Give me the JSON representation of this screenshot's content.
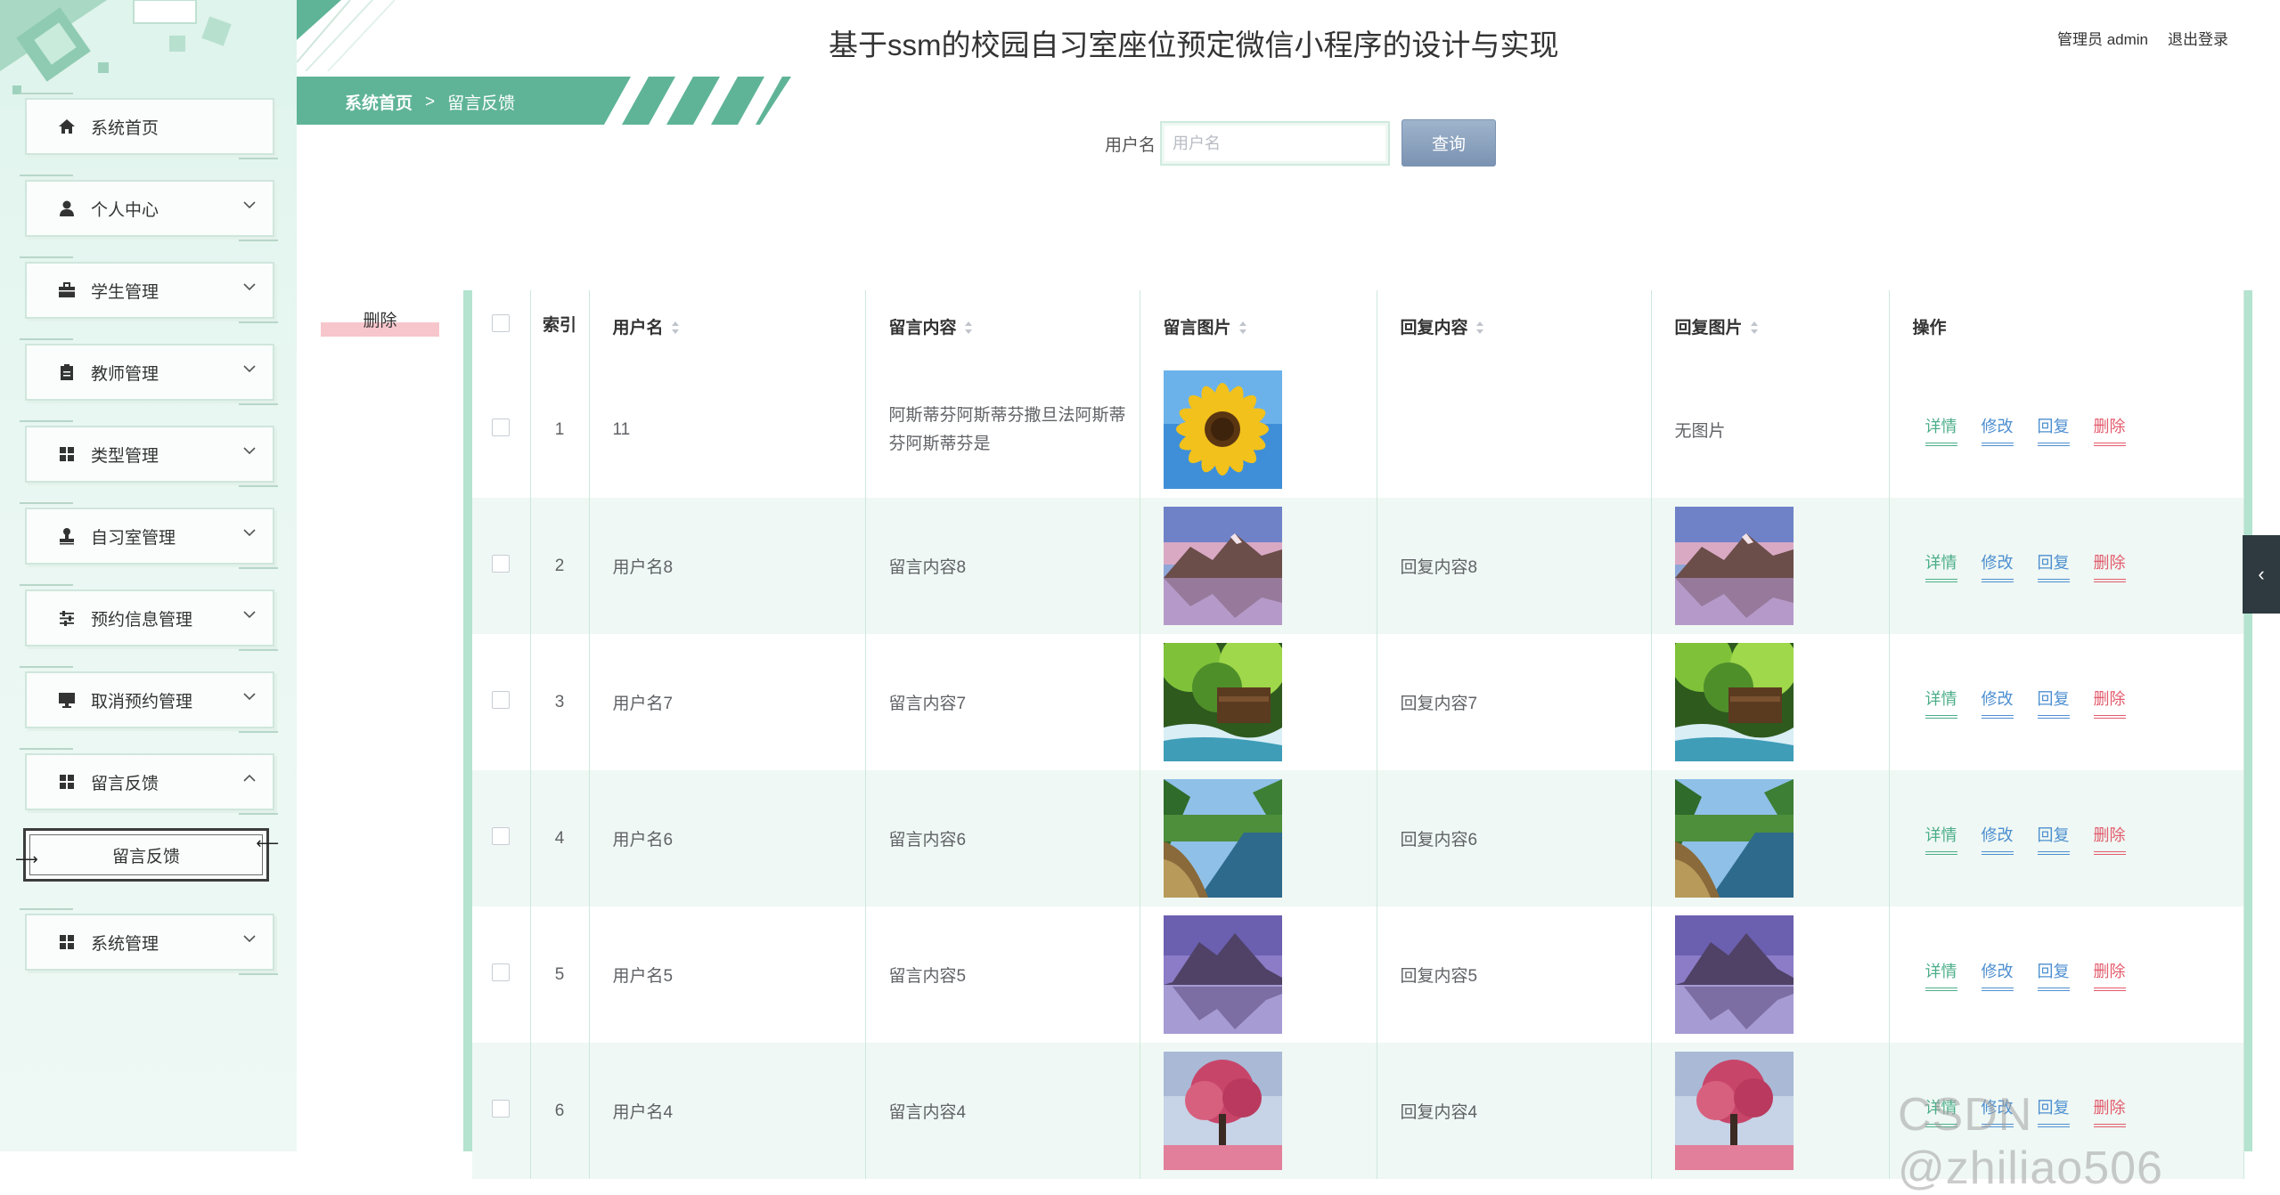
{
  "header": {
    "title": "基于ssm的校园自习室座位预定微信小程序的设计与实现",
    "user": "管理员 admin",
    "logout": "退出登录"
  },
  "sidebar": {
    "items": [
      {
        "label": "系统首页",
        "icon": "home-icon"
      },
      {
        "label": "个人中心",
        "icon": "user-icon"
      },
      {
        "label": "学生管理",
        "icon": "briefcase-icon"
      },
      {
        "label": "教师管理",
        "icon": "clipboard-icon"
      },
      {
        "label": "类型管理",
        "icon": "grid-icon"
      },
      {
        "label": "自习室管理",
        "icon": "stamp-icon"
      },
      {
        "label": "预约信息管理",
        "icon": "sliders-icon"
      },
      {
        "label": "取消预约管理",
        "icon": "monitor-icon"
      },
      {
        "label": "留言反馈",
        "icon": "grid-icon"
      },
      {
        "label": "系统管理",
        "icon": "grid-icon"
      }
    ],
    "submenu_label": "留言反馈"
  },
  "breadcrumb": {
    "home": "系统首页",
    "separator": ">",
    "current": "留言反馈"
  },
  "search": {
    "label": "用户名",
    "placeholder": "用户名",
    "value": "",
    "button": "查询"
  },
  "batch_delete": "删除",
  "table": {
    "headers": {
      "index": "索引",
      "username": "用户名",
      "message": "留言内容",
      "message_image": "留言图片",
      "reply": "回复内容",
      "reply_image": "回复图片",
      "actions": "操作"
    },
    "actions": {
      "detail": "详情",
      "edit": "修改",
      "reply": "回复",
      "delete": "删除"
    },
    "no_image": "无图片",
    "rows": [
      {
        "index": "1",
        "username": "11",
        "message": "阿斯蒂芬阿斯蒂芬撒旦法阿斯蒂芬阿斯蒂芬是",
        "reply": "",
        "img": "sunflower",
        "reply_img": ""
      },
      {
        "index": "2",
        "username": "用户名8",
        "message": "留言内容8",
        "reply": "回复内容8",
        "img": "mountain-lake",
        "reply_img": "mountain-lake"
      },
      {
        "index": "3",
        "username": "用户名7",
        "message": "留言内容7",
        "reply": "回复内容7",
        "img": "forest-waterfall",
        "reply_img": "forest-waterfall"
      },
      {
        "index": "4",
        "username": "用户名6",
        "message": "留言内容6",
        "reply": "回复内容6",
        "img": "forest-river",
        "reply_img": "forest-river"
      },
      {
        "index": "5",
        "username": "用户名5",
        "message": "留言内容5",
        "reply": "回复内容5",
        "img": "purple-mountain",
        "reply_img": "purple-mountain"
      },
      {
        "index": "6",
        "username": "用户名4",
        "message": "留言内容4",
        "reply": "回复内容4",
        "img": "pink-tree",
        "reply_img": "pink-tree"
      }
    ]
  },
  "watermark": "CSDN @zhiliao506",
  "colors": {
    "accent": "#4cae8a",
    "sidebar_bg": "#e6f5ef",
    "breadcrumb_bg": "#5fb497",
    "delete": "#e35b6c",
    "link": "#4d8fd0"
  }
}
